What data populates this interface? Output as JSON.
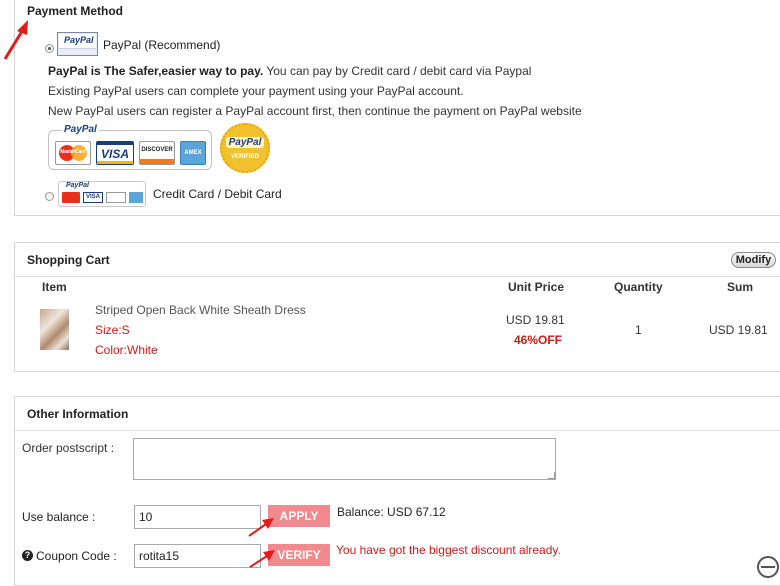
{
  "payment": {
    "title": "Payment Method",
    "paypal_option_label": "PayPal (Recommend)",
    "paypal_small_logo": "PayPal",
    "desc_bold": "PayPal is The Safer,easier way to pay.",
    "desc_rest": "You can pay by Credit card / debit card via Paypal",
    "line2": "Existing PayPal users can complete your payment using your PayPal account.",
    "line3": "New PayPal users can register a PayPal account first, then continue the payment on PayPal website",
    "banner_brand": "PayPal",
    "cards": [
      "MasterCard",
      "VISA",
      "DISCOVER",
      "AMEX"
    ],
    "seal_top": "PayPal",
    "seal_bottom": "VERIFIED",
    "credit_option_label": "Credit Card / Debit Card"
  },
  "cart": {
    "title": "Shopping Cart",
    "modify_label": "Modify",
    "columns": [
      "Item",
      "Unit Price",
      "Quantity",
      "Sum"
    ],
    "item": {
      "name": "Striped Open Back White Sheath Dress",
      "size": "Size:S",
      "color": "Color:White",
      "unit_price": "USD 19.81",
      "discount": "46%OFF",
      "quantity": "1",
      "sum": "USD 19.81"
    }
  },
  "other": {
    "title": "Other Information",
    "postscript_label": "Order postscript :",
    "postscript_value": "",
    "balance_label": "Use balance :",
    "balance_value": "10",
    "apply_label": "APPLY",
    "balance_info": "Balance: USD 67.12",
    "coupon_label": "Coupon Code :",
    "coupon_value": "rotita15",
    "verify_label": "VERIFY",
    "coupon_message": "You have got the biggest discount already."
  },
  "colors": {
    "accent_red": "#cc1b1b",
    "button_pink": "#f08a8e",
    "arrow_red": "#e31b1b"
  }
}
